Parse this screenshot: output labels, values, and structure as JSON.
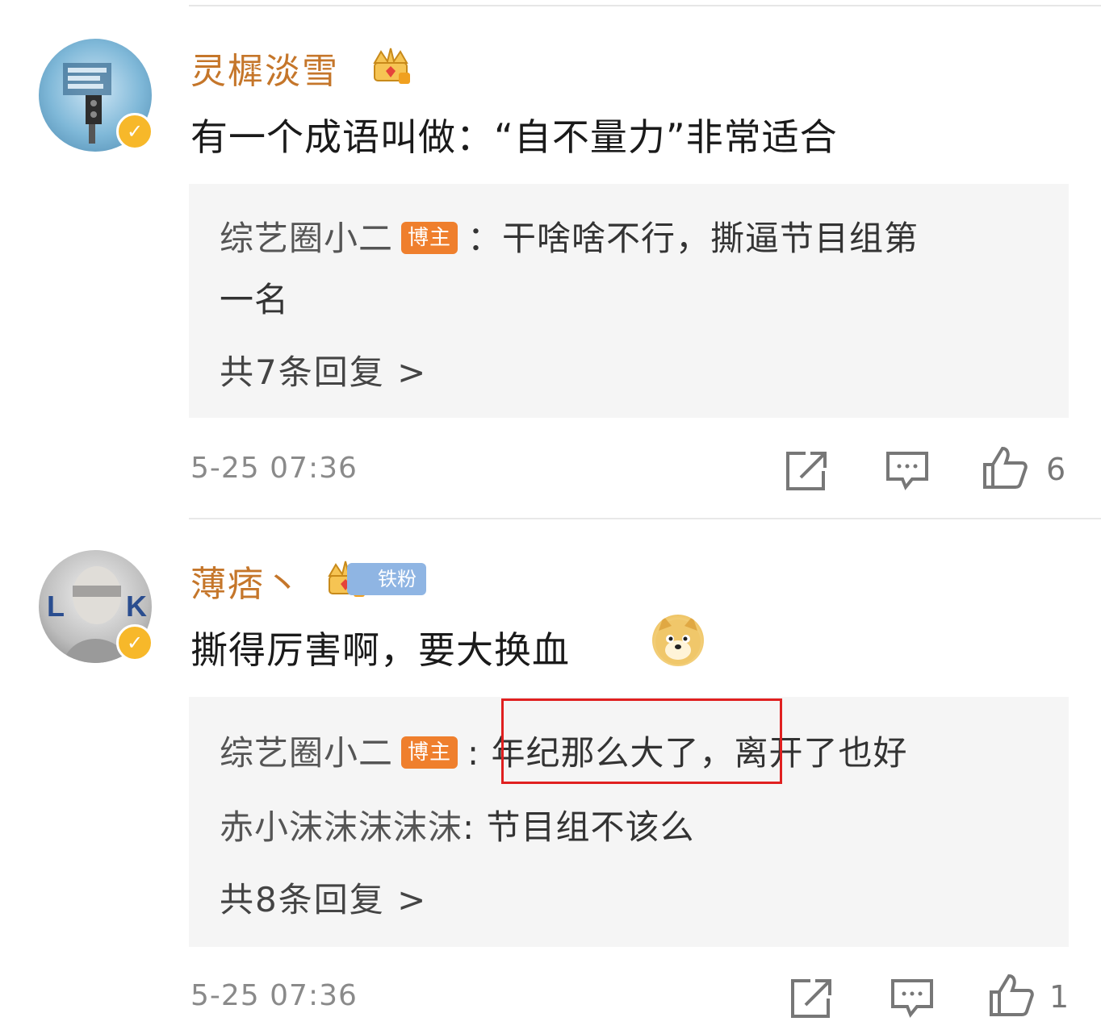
{
  "comments": [
    {
      "username": "灵樨淡雪",
      "text": "有一个成语叫做：“自不量力”非常适合",
      "replies": [
        {
          "user": "综艺圈小二",
          "badge": "博主",
          "text": "：干啥啥不行，撕逼节目组第",
          "text_cont": "一名"
        }
      ],
      "total_replies": "共7条回复 >",
      "time": "5-25 07:36",
      "likes": "6"
    },
    {
      "username": "薄痞丶",
      "fan_badge": "铁粉",
      "text": "撕得厉害啊，要大换血",
      "replies": [
        {
          "user": "综艺圈小二",
          "badge": "博主",
          "text_highlight": ": 年纪那么大了",
          "text_rest": "，离开了也好"
        },
        {
          "user": "赤小沫沫沫沫沫",
          "text": ": 节目组不该么"
        }
      ],
      "total_replies": "共8条回复 >",
      "time": "5-25 07:36",
      "likes": "1"
    }
  ],
  "colors": {
    "username": "#c5762a",
    "bozhu_badge": "#ef7f2d",
    "tiefen_badge": "#8fb5e3",
    "verify_badge": "#f7b82a",
    "highlight_box": "#e02020"
  }
}
